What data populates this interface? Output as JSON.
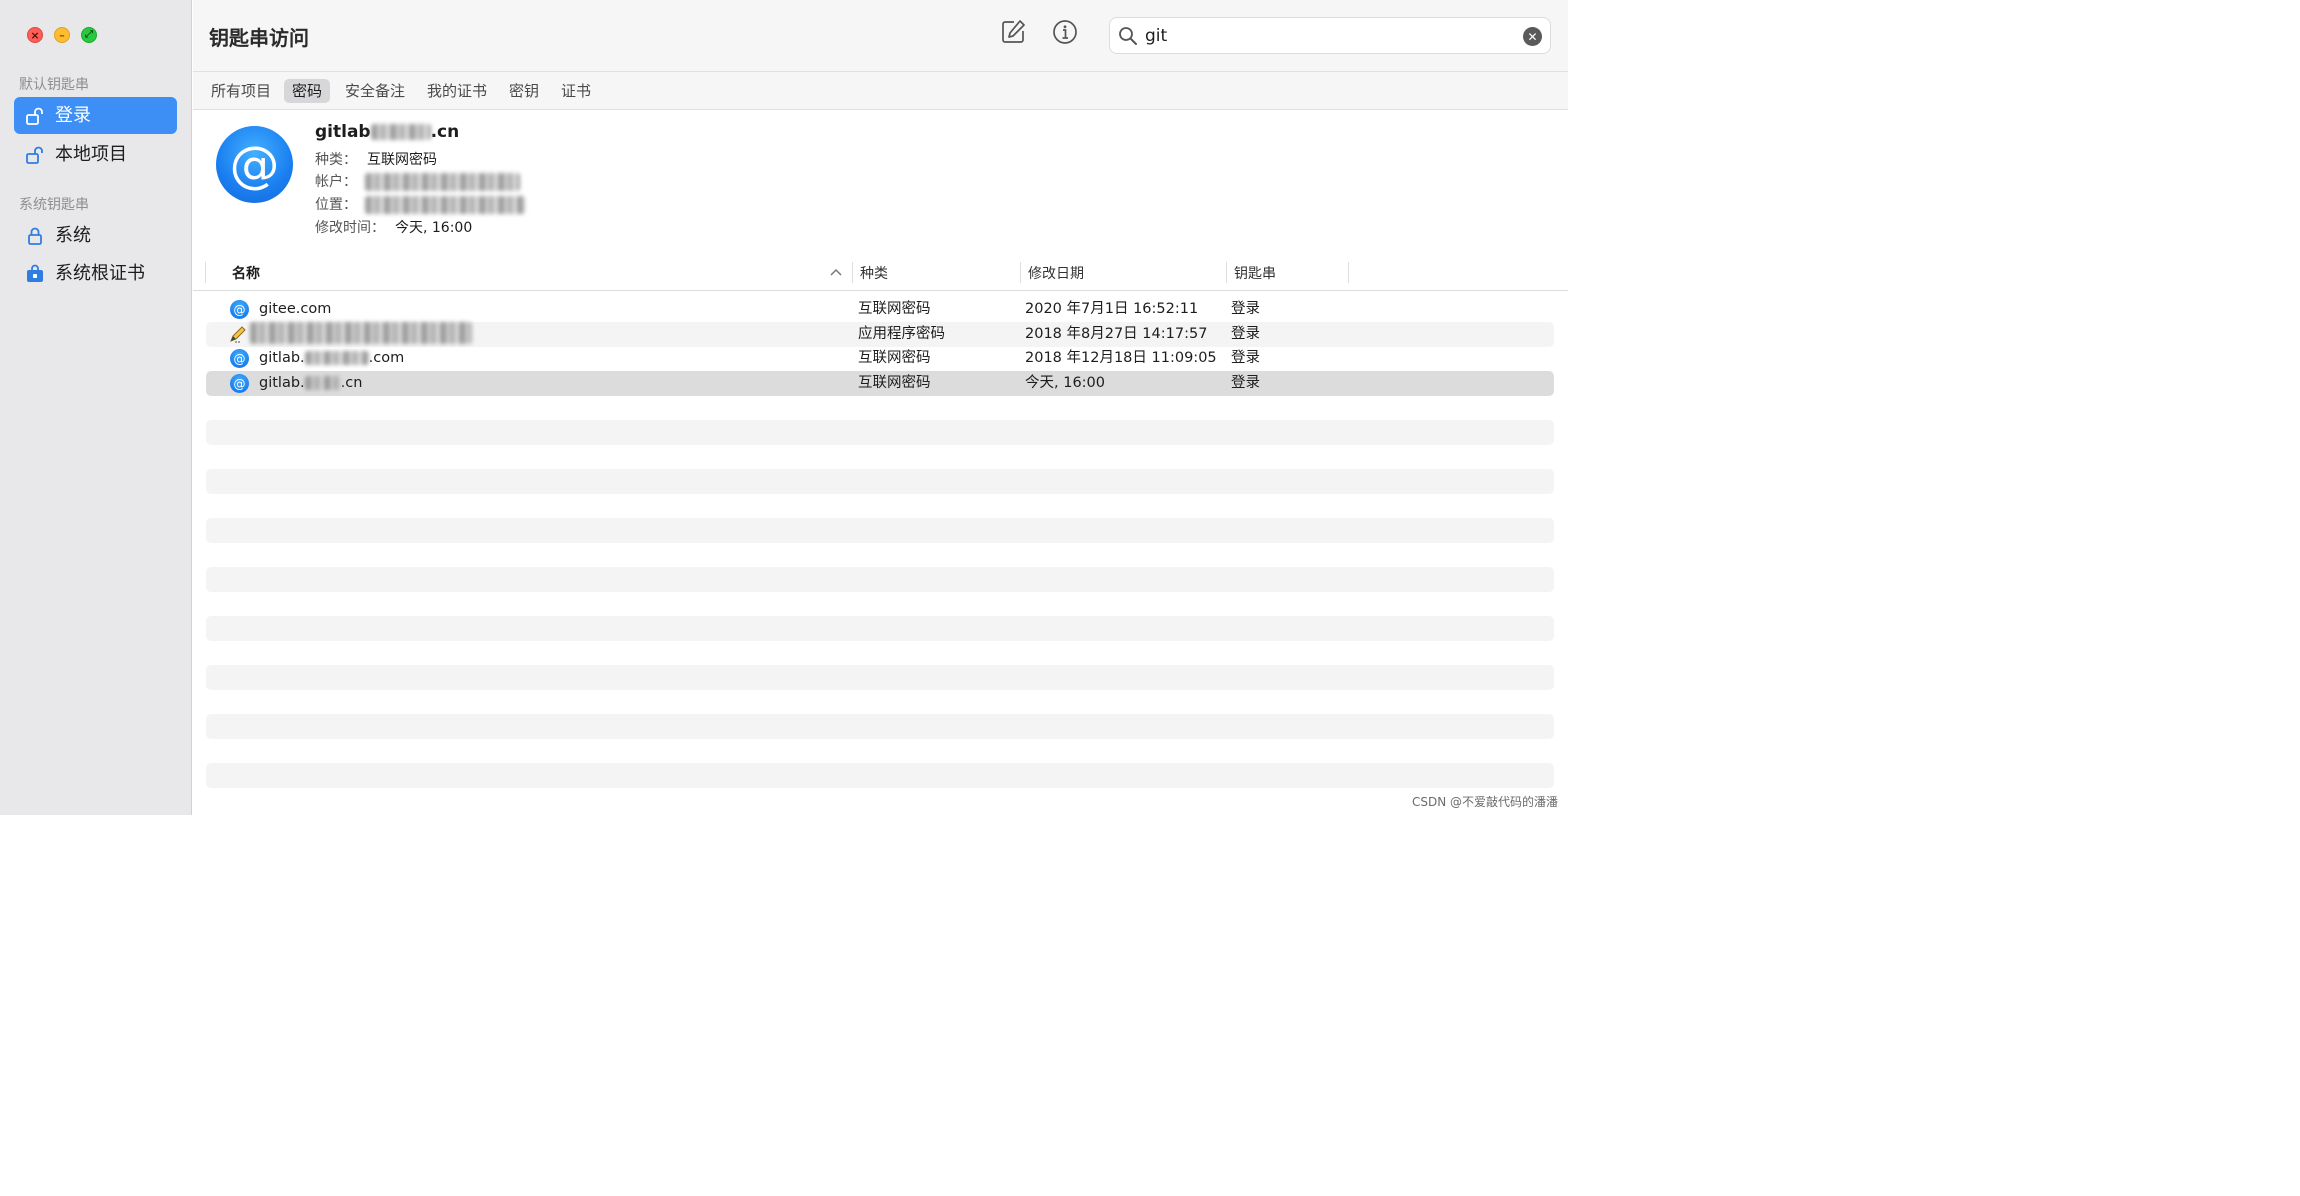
{
  "window": {
    "title": "钥匙串访问"
  },
  "traffic_lights": {
    "close": "×",
    "minimize": "–",
    "zoom": "⤢"
  },
  "sidebar": {
    "sections": [
      {
        "header": "默认钥匙串",
        "items": [
          {
            "label": "登录",
            "icon": "unlocked-padlock-icon",
            "selected": true
          },
          {
            "label": "本地项目",
            "icon": "unlocked-padlock-icon",
            "selected": false
          }
        ]
      },
      {
        "header": "系统钥匙串",
        "items": [
          {
            "label": "系统",
            "icon": "locked-padlock-icon",
            "selected": false
          },
          {
            "label": "系统根证书",
            "icon": "locked-cabinet-icon",
            "selected": false
          }
        ]
      }
    ]
  },
  "toolbar": {
    "compose_icon": "compose-icon",
    "info_icon": "info-icon",
    "search": {
      "value": "git",
      "icon": "search-icon",
      "clear_icon": "clear-icon",
      "clear_glyph": "✕"
    }
  },
  "tabs": [
    {
      "label": "所有项目",
      "active": false
    },
    {
      "label": "密码",
      "active": true
    },
    {
      "label": "安全备注",
      "active": false
    },
    {
      "label": "我的证书",
      "active": false
    },
    {
      "label": "密钥",
      "active": false
    },
    {
      "label": "证书",
      "active": false
    }
  ],
  "detail": {
    "icon_glyph": "@",
    "title_prefix": "gitlab",
    "title_suffix": ".cn",
    "kind_label": "种类：",
    "kind_value": "互联网密码",
    "account_label": "帐户：",
    "location_label": "位置：",
    "modified_label": "修改时间：",
    "modified_value": "今天, 16:00"
  },
  "table": {
    "columns": {
      "name": "名称",
      "kind": "种类",
      "modified": "修改日期",
      "keychain": "钥匙串"
    },
    "sort_icon": "chevron-up-icon",
    "rows": [
      {
        "icon": "at-sign-icon",
        "name_prefix": "gitee.com",
        "name_suffix": "",
        "redacted": false,
        "kind": "互联网密码",
        "modified": "2020 年7月1日 16:52:11",
        "keychain": "登录"
      },
      {
        "icon": "pencil-icon",
        "name_prefix": "",
        "name_suffix": "",
        "redacted": true,
        "kind": "应用程序密码",
        "modified": "2018 年8月27日 14:17:57",
        "keychain": "登录"
      },
      {
        "icon": "at-sign-icon",
        "name_prefix": "gitlab.",
        "name_suffix": ".com",
        "redacted": true,
        "kind": "互联网密码",
        "modified": "2018 年12月18日 11:09:05",
        "keychain": "登录"
      },
      {
        "icon": "at-sign-icon",
        "name_prefix": "gitlab.",
        "name_suffix": ".cn",
        "redacted": true,
        "kind": "互联网密码",
        "modified": "今天, 16:00",
        "keychain": "登录"
      }
    ],
    "selected_row": 3
  },
  "watermark": "CSDN @不爱敲代码的潘潘"
}
